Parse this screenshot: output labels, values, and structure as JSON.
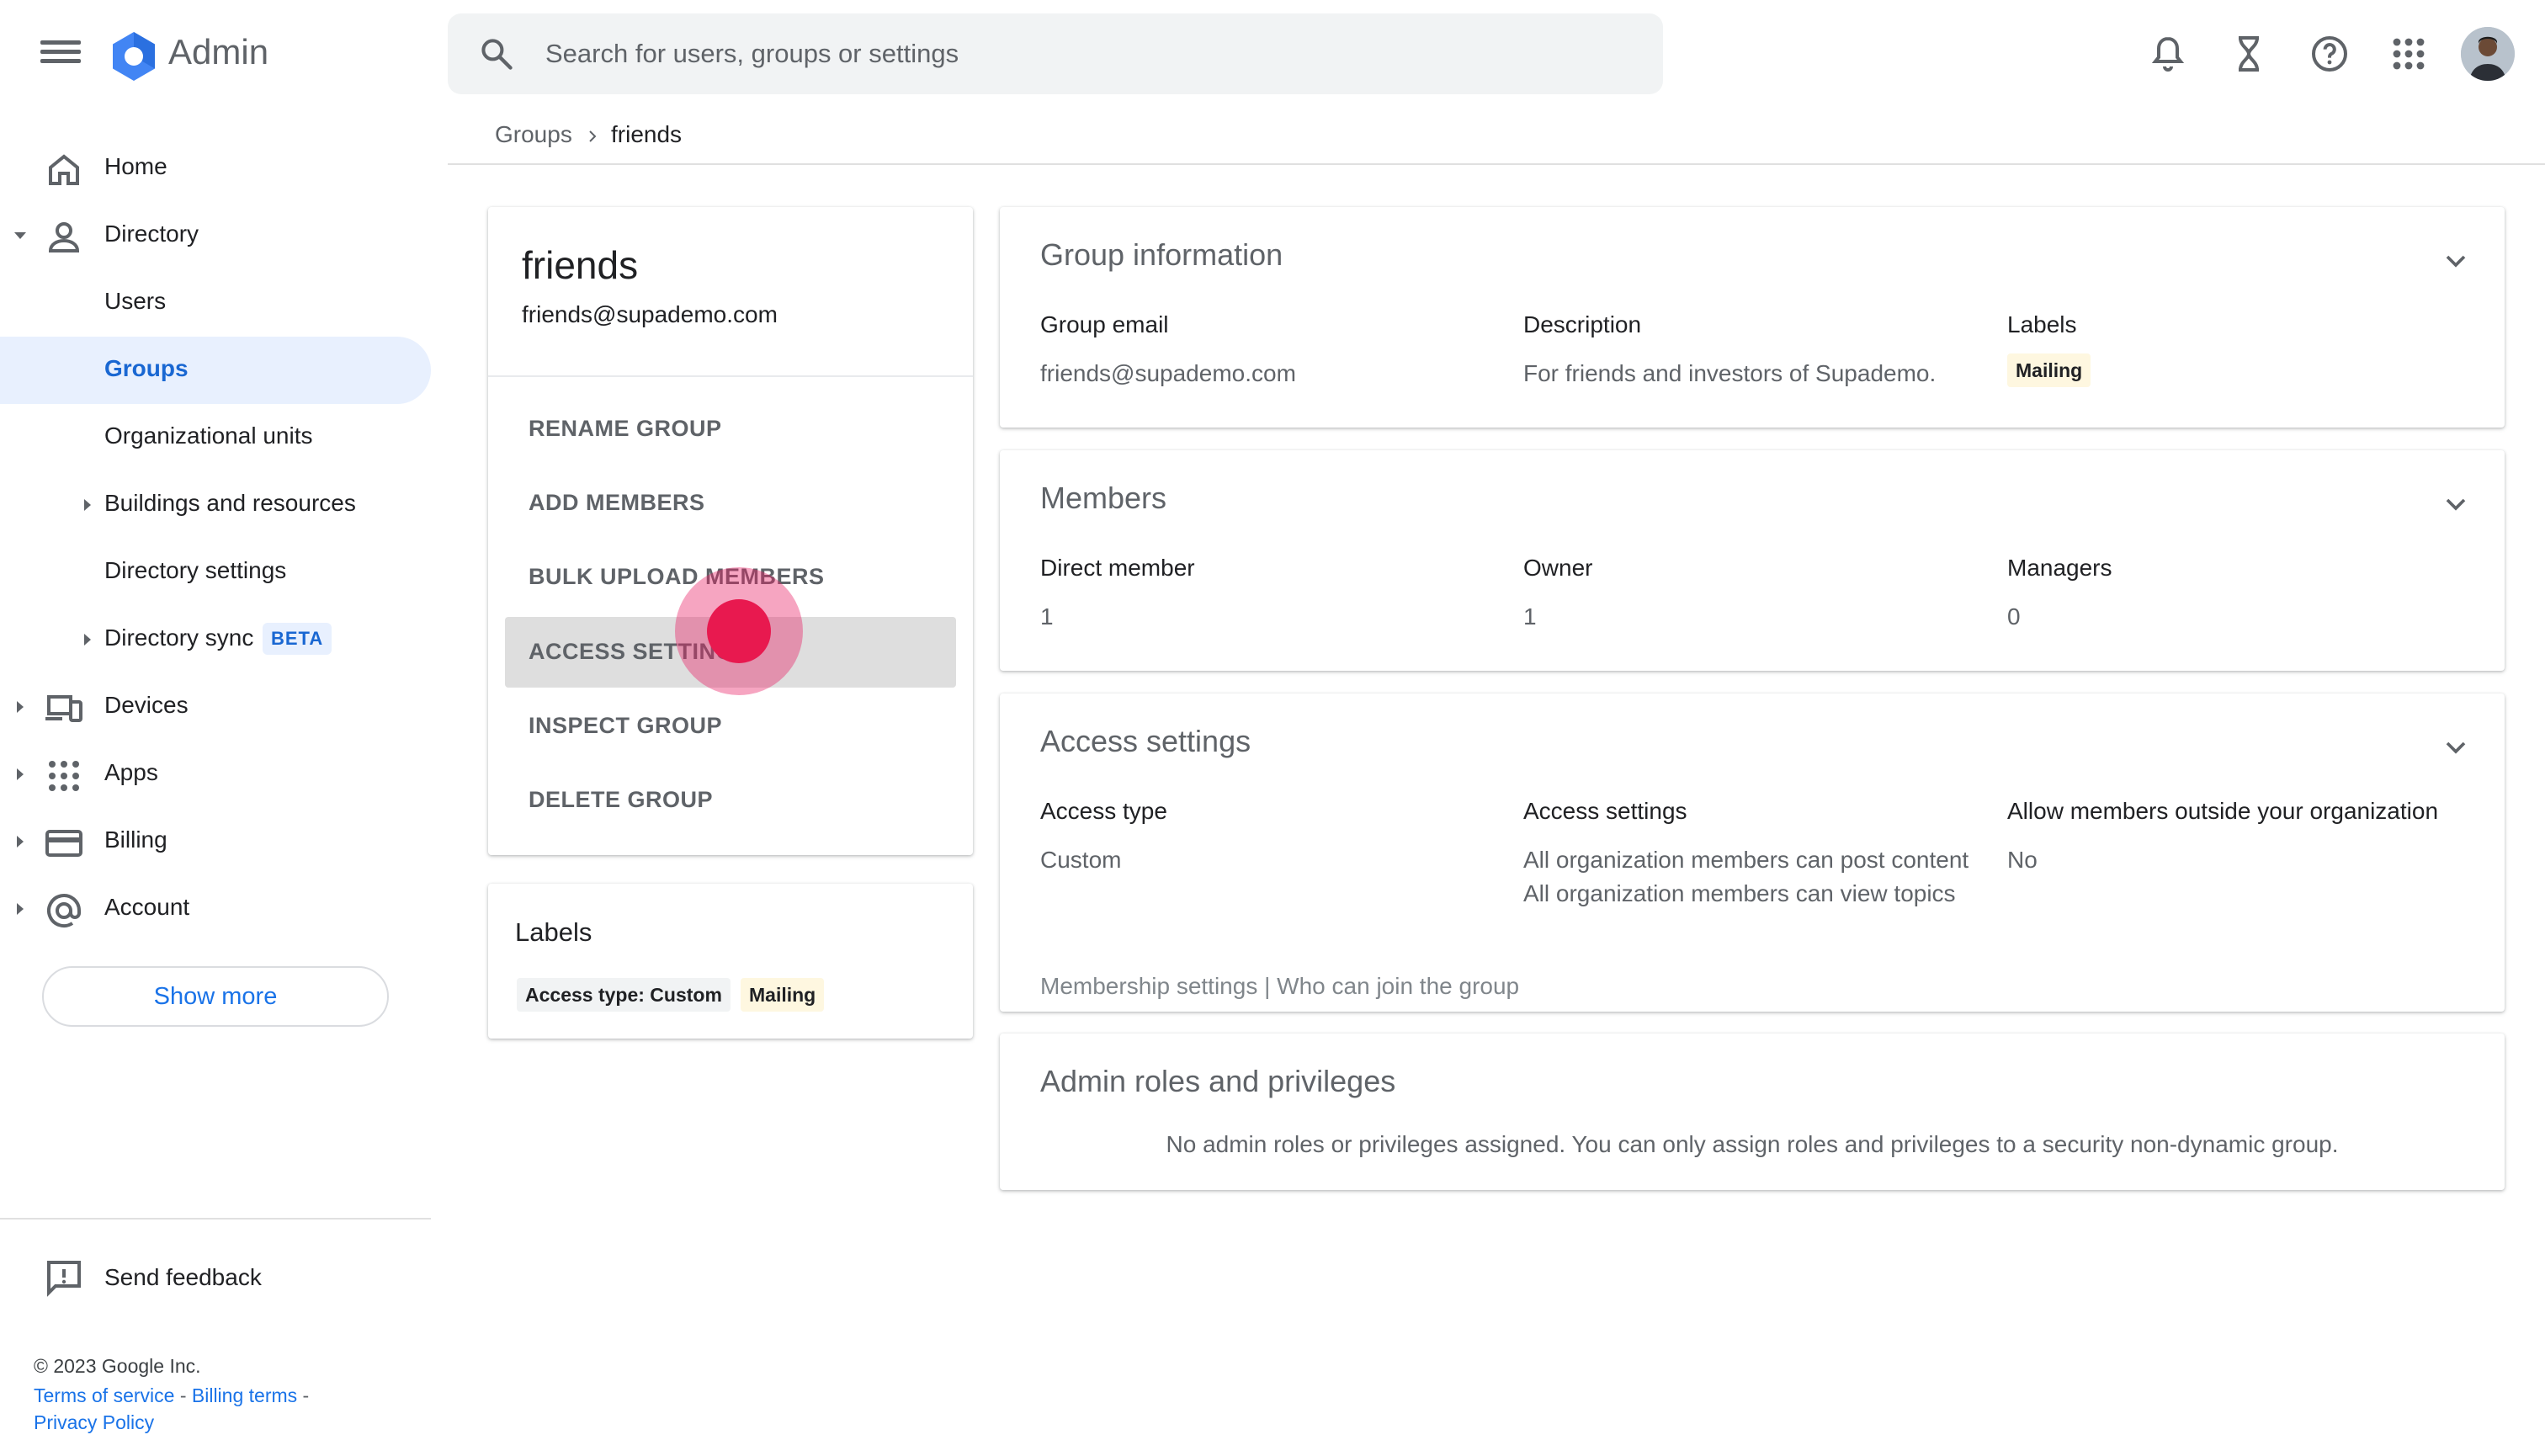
{
  "app": {
    "brand": "Admin"
  },
  "search": {
    "placeholder": "Search for users, groups or settings"
  },
  "breadcrumb": {
    "parent": "Groups",
    "current": "friends"
  },
  "sidebar": {
    "items": [
      {
        "label": "Home"
      },
      {
        "label": "Directory"
      },
      {
        "label": "Users"
      },
      {
        "label": "Groups"
      },
      {
        "label": "Organizational units"
      },
      {
        "label": "Buildings and resources"
      },
      {
        "label": "Directory settings"
      },
      {
        "label": "Directory sync",
        "badge": "BETA"
      },
      {
        "label": "Devices"
      },
      {
        "label": "Apps"
      },
      {
        "label": "Billing"
      },
      {
        "label": "Account"
      }
    ],
    "show_more": "Show more",
    "feedback": "Send feedback",
    "copyright": "© 2023 Google Inc.",
    "legal": {
      "terms": "Terms of service",
      "billing": "Billing terms",
      "privacy": "Privacy Policy",
      "sep": " - "
    }
  },
  "group": {
    "name": "friends",
    "email": "friends@supademo.com",
    "actions": [
      "RENAME GROUP",
      "ADD MEMBERS",
      "BULK UPLOAD MEMBERS",
      "ACCESS SETTINGS",
      "INSPECT GROUP",
      "DELETE GROUP"
    ],
    "labels_title": "Labels",
    "labels": [
      "Access type: Custom",
      "Mailing"
    ]
  },
  "group_info": {
    "title": "Group information",
    "email_label": "Group email",
    "email_value": "friends@supademo.com",
    "description_label": "Description",
    "description_value": "For friends and investors of Supademo.",
    "labels_label": "Labels",
    "labels_value": "Mailing"
  },
  "members": {
    "title": "Members",
    "direct_label": "Direct member",
    "direct_value": "1",
    "owner_label": "Owner",
    "owner_value": "1",
    "managers_label": "Managers",
    "managers_value": "0"
  },
  "access": {
    "title": "Access settings",
    "type_label": "Access type",
    "type_value": "Custom",
    "settings_label": "Access settings",
    "settings_line1": "All organization members can post content",
    "settings_line2": "All organization members can view topics",
    "outside_label": "Allow members outside your organization",
    "outside_value": "No",
    "membership_link": "Membership settings | Who can join the group"
  },
  "admin_roles": {
    "title": "Admin roles and privileges",
    "message": "No admin roles or privileges assigned. You can only assign roles and privileges to a security non-dynamic group."
  },
  "colors": {
    "accent": "#1a73e8",
    "active_bg": "#e8f0fe",
    "click": "#e8194f",
    "chip_yellow": "#fef7e0"
  },
  "icons": [
    "menu-icon",
    "admin-logo-icon",
    "search-icon",
    "bell-icon",
    "hourglass-icon",
    "help-icon",
    "apps-grid-icon",
    "home-icon",
    "person-icon",
    "devices-icon",
    "billing-card-icon",
    "at-sign-icon",
    "feedback-icon",
    "chevron-down-icon"
  ]
}
